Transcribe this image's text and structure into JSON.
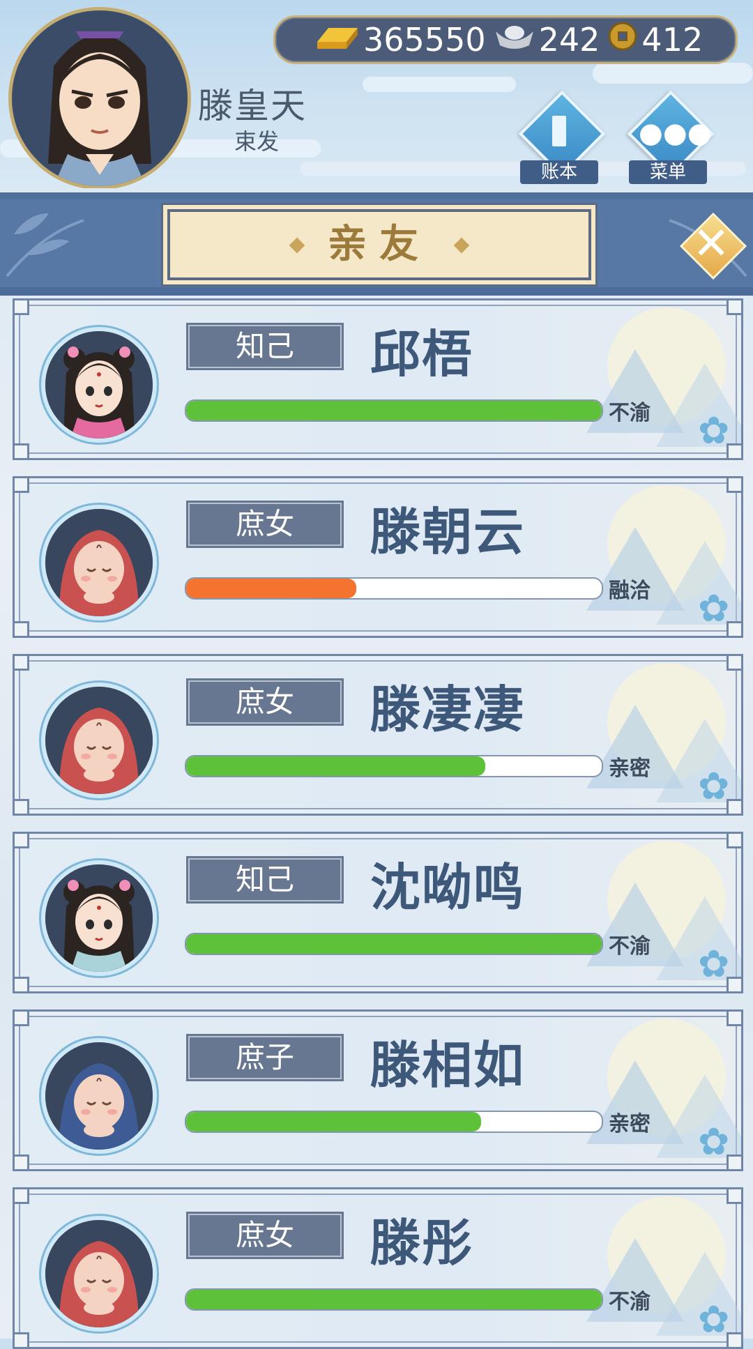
{
  "header": {
    "player_name": "滕皇天",
    "player_subtitle": "束发",
    "currency": {
      "gold": "365550",
      "silver": "242",
      "coin": "412"
    },
    "buttons": {
      "ledger": "账本",
      "menu": "菜单"
    }
  },
  "panel": {
    "title": "亲友",
    "close_label": "✕"
  },
  "colors": {
    "bar_green": "#5ec13a",
    "bar_orange": "#f3732f"
  },
  "relatives": [
    {
      "tag": "知己",
      "name": "邱梧",
      "status": "不渝",
      "affinity": 1.0,
      "bar_color": "green",
      "avatar": "girl-flowers-pink-robe"
    },
    {
      "tag": "庶女",
      "name": "滕朝云",
      "status": "融洽",
      "affinity": 0.41,
      "bar_color": "orange",
      "avatar": "baby-red-hood"
    },
    {
      "tag": "庶女",
      "name": "滕凄凄",
      "status": "亲密",
      "affinity": 0.72,
      "bar_color": "green",
      "avatar": "baby-red-hood"
    },
    {
      "tag": "知己",
      "name": "沈呦鸣",
      "status": "不渝",
      "affinity": 1.0,
      "bar_color": "green",
      "avatar": "girl-flowers-blue-robe"
    },
    {
      "tag": "庶子",
      "name": "滕相如",
      "status": "亲密",
      "affinity": 0.71,
      "bar_color": "green",
      "avatar": "baby-blue-hood"
    },
    {
      "tag": "庶女",
      "name": "滕彤",
      "status": "不渝",
      "affinity": 1.0,
      "bar_color": "green",
      "avatar": "baby-red-hood"
    }
  ]
}
